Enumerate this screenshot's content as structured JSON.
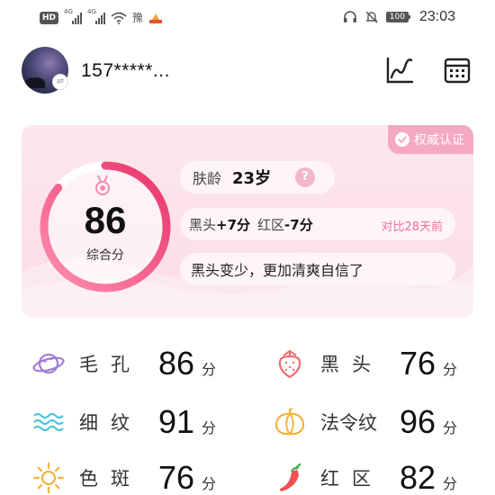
{
  "status_bar": {
    "hd_badge": "HD",
    "network_1": "4G",
    "network_2": "4G",
    "app_glyph": "豫",
    "battery": "100",
    "time": "23:03"
  },
  "header": {
    "user_name": "157*****...",
    "icons": [
      "avatar",
      "switch-account-icon",
      "trend-chart-icon",
      "calendar-icon"
    ]
  },
  "score_card": {
    "auth_badge": "权威认证",
    "score": "86",
    "score_label": "综合分",
    "skin_age_label": "肤龄",
    "skin_age_value": "23岁",
    "help_glyph": "?",
    "compare": {
      "blackhead_label": "黑头",
      "blackhead_delta": "+7分",
      "redness_label": "红区",
      "redness_delta": "-7分",
      "period": "对比28天前"
    },
    "summary": "黑头变少，更加清爽自信了",
    "progress": 0.86,
    "accent_color": "#f2467a"
  },
  "metrics": [
    {
      "label": "毛孔",
      "value": "86",
      "unit": "分",
      "icon": "planet-icon",
      "color": "#a27bd6"
    },
    {
      "label": "黑头",
      "value": "76",
      "unit": "分",
      "icon": "strawberry-icon",
      "color": "#f06e6e"
    },
    {
      "label": "细纹",
      "value": "91",
      "unit": "分",
      "icon": "wave-lines-icon",
      "color": "#4cc6d8"
    },
    {
      "label": "法令纹",
      "value": "96",
      "unit": "分",
      "icon": "pumpkin-icon",
      "color": "#f3b43c"
    },
    {
      "label": "色斑",
      "value": "76",
      "unit": "分",
      "icon": "sun-icon",
      "color": "#f3b43c"
    },
    {
      "label": "红区",
      "value": "82",
      "unit": "分",
      "icon": "chili-icon",
      "color": "#ef5150"
    }
  ]
}
